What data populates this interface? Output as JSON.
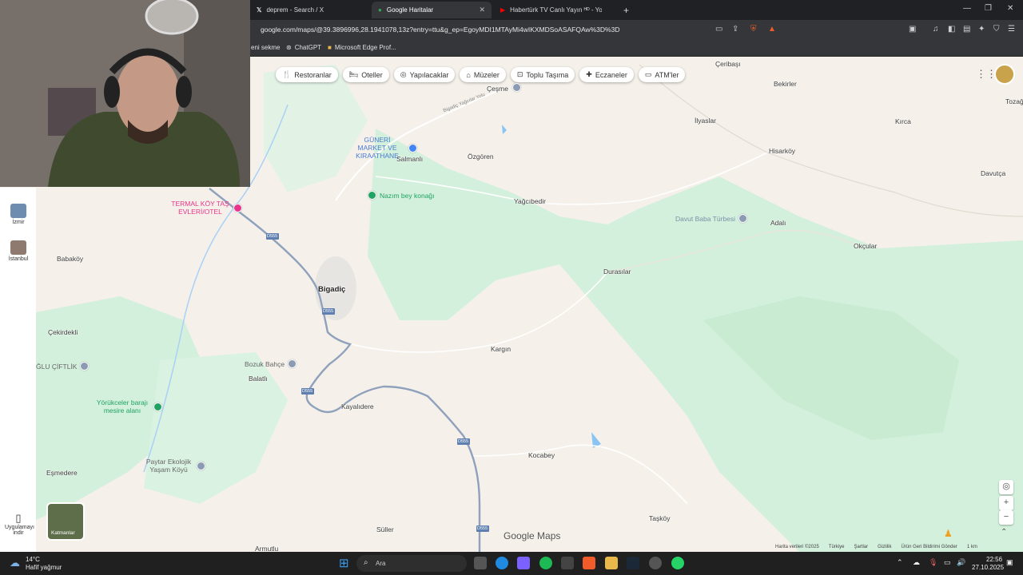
{
  "browser": {
    "tabs": [
      {
        "label": "deprem - Search / X",
        "icon": "x-logo-icon"
      },
      {
        "label": "Google Haritalar",
        "icon": "google-maps-icon"
      },
      {
        "label": "Habertürk TV Canlı Yayın ᴴᴰ - You",
        "icon": "youtube-icon"
      }
    ],
    "new_tab": "+",
    "url": "google.com/maps/@39.3896996,28.1941078,13z?entry=ttu&g_ep=EgoyMDI1MTAyMi4wIKXMDSoASAFQAw%3D%3D",
    "bookmarks": [
      "eni sekme",
      "ChatGPT",
      "Microsoft Edge Prof..."
    ]
  },
  "map": {
    "categories": [
      "Restoranlar",
      "Oteller",
      "Yapılacaklar",
      "Müzeler",
      "Toplu Taşıma",
      "Eczaneler",
      "ATM'ler"
    ],
    "places": [
      {
        "name": "Çeribaşı"
      },
      {
        "name": "Bekirler"
      },
      {
        "name": "Tozağ"
      },
      {
        "name": "İlyaslar"
      },
      {
        "name": "Kırca"
      },
      {
        "name": "Çeşme"
      },
      {
        "name": "Salmanlı"
      },
      {
        "name": "Özgören"
      },
      {
        "name": "Hisarköy"
      },
      {
        "name": "Davutça"
      },
      {
        "name": "Yağcıbedir"
      },
      {
        "name": "Adalı"
      },
      {
        "name": "Okçular"
      },
      {
        "name": "Babaköy"
      },
      {
        "name": "Durasılar"
      },
      {
        "name": "Bigadiç"
      },
      {
        "name": "Çekirdekli"
      },
      {
        "name": "Kargın"
      },
      {
        "name": "Balatlı"
      },
      {
        "name": "Kayalıdere"
      },
      {
        "name": "Kocabey"
      },
      {
        "name": "Eşmedere"
      },
      {
        "name": "Taşköy"
      },
      {
        "name": "Süller"
      },
      {
        "name": "Armutlu"
      }
    ],
    "pois": [
      {
        "name": "GÜNERİ MARKET VE KIRAATHANE"
      },
      {
        "name": "Nazım bey konağı"
      },
      {
        "name": "TERMAL KÖY TAŞ EVLERİ/OTEL"
      },
      {
        "name": "Davut Baba Türbesi"
      },
      {
        "name": "Bozuk Bahçe"
      },
      {
        "name": "ĞLU ÇİFTLİK"
      },
      {
        "name": "Yörükceler barajı mesire alanı"
      },
      {
        "name": "Paytar Ekolojik Yaşam Köyü"
      }
    ],
    "road_labels": [
      "D555",
      "D555",
      "D555",
      "D555",
      "D555"
    ],
    "road_small_label": "Bigadiç Yağcılar Yolu",
    "left_panel": [
      {
        "label": "İzmir"
      },
      {
        "label": "İstanbul"
      }
    ],
    "download_app": "Uygulamayı indir",
    "layers_label": "Katmanlar",
    "logo": "Google Maps",
    "footer": [
      "Harita verileri ©2025",
      "Türkiye",
      "Şartlar",
      "Gizlilik",
      "Ürün Geri Bildirimi Gönder",
      "1 km"
    ],
    "colors": {
      "land": "#f5f1ea",
      "green": "#ccefd5",
      "road": "#8fa1bc",
      "poi_pink": "#e8348a",
      "poi_green": "#1fa363"
    }
  },
  "taskbar": {
    "weather_temp": "14°C",
    "weather_desc": "Hafif yağmur",
    "search": "Ara",
    "time": "22:56",
    "date": "27.10.2025"
  }
}
